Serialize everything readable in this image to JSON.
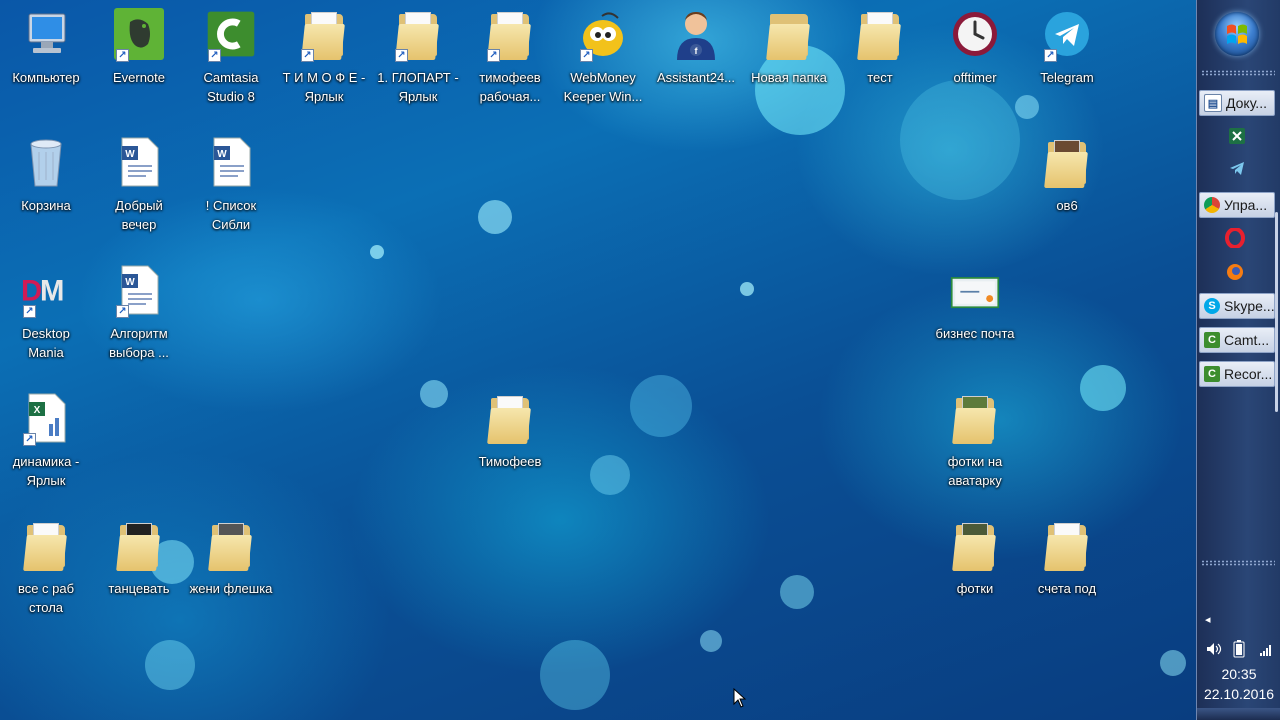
{
  "desktop": {
    "icons": [
      {
        "label": "Компьютер",
        "icon": "computer-icon"
      },
      {
        "label": "Evernote",
        "icon": "evernote-icon"
      },
      {
        "label": "Camtasia\nStudio 8",
        "icon": "camtasia-icon"
      },
      {
        "label": "Т И М О Ф Е -\nЯрлык",
        "icon": "folder-icon"
      },
      {
        "label": "1. ГЛОПАРТ -\nЯрлык",
        "icon": "folder-icon"
      },
      {
        "label": "тимофеев\nрабочая...",
        "icon": "folder-icon"
      },
      {
        "label": "WebMoney\nKeeper Win...",
        "icon": "webmoney-icon"
      },
      {
        "label": "Assistant24...",
        "icon": "user-icon"
      },
      {
        "label": "Новая папка",
        "icon": "folder-icon"
      },
      {
        "label": "тест",
        "icon": "folder-icon"
      },
      {
        "label": "offtimer",
        "icon": "clock-icon"
      },
      {
        "label": "Telegram",
        "icon": "telegram-icon"
      },
      {
        "label": "Корзина",
        "icon": "recycle-bin-icon"
      },
      {
        "label": "Добрый\nвечер",
        "icon": "word-document-icon"
      },
      {
        "label": "! Список\nСибли",
        "icon": "word-document-icon"
      },
      {
        "label": "ов6",
        "icon": "folder-icon"
      },
      {
        "label": "Desktop\nMania",
        "icon": "desktop-mania-icon"
      },
      {
        "label": "Алгоритм\nвыбора ...",
        "icon": "word-document-icon"
      },
      {
        "label": "бизнес почта",
        "icon": "video-file-icon"
      },
      {
        "label": "динамика -\nЯрлык",
        "icon": "excel-chart-icon"
      },
      {
        "label": "Тимофеев",
        "icon": "folder-icon"
      },
      {
        "label": "фотки на\nаватарку",
        "icon": "folder-icon"
      },
      {
        "label": "все с раб\nстола",
        "icon": "folder-icon"
      },
      {
        "label": "танцевать",
        "icon": "folder-icon"
      },
      {
        "label": "жени флешка",
        "icon": "folder-icon"
      },
      {
        "label": "фотки",
        "icon": "folder-icon"
      },
      {
        "label": "счета под",
        "icon": "folder-icon"
      }
    ]
  },
  "taskbar": {
    "start_icon": "windows-orb-icon",
    "buttons": [
      {
        "label": "Доку...",
        "icon": "document-icon"
      },
      {
        "label": "Упра...",
        "icon": "chrome-icon"
      },
      {
        "label": "Skype...",
        "icon": "skype-icon"
      },
      {
        "label": "Camt...",
        "icon": "camtasia-icon"
      },
      {
        "label": "Recor...",
        "icon": "camtasia-icon"
      }
    ],
    "pinned": [
      "excel-icon",
      "telegram-icon",
      "opera-icon",
      "firefox-icon"
    ],
    "tray": [
      "chevron-left-icon",
      "speaker-icon",
      "battery-icon",
      "signal-icon"
    ],
    "time": "20:35",
    "date": "22.10.2016"
  }
}
